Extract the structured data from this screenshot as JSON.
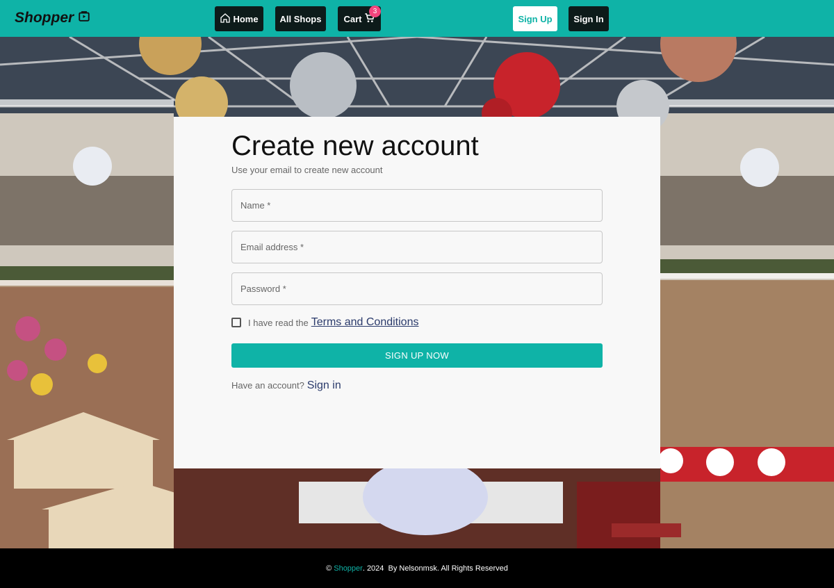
{
  "header": {
    "logo_text": "Shopper",
    "nav": {
      "home_label": "Home",
      "shops_label": "All Shops",
      "cart_label": "Cart",
      "cart_count": "3"
    },
    "signup_label": "Sign Up",
    "signin_label": "Sign In",
    "colors": {
      "brand": "#0fb3a7",
      "badge": "#f2457d",
      "nav_bg": "#0d1b1a"
    }
  },
  "form": {
    "title": "Create new account",
    "subtitle": "Use your email to create new account",
    "name_placeholder": "Name *",
    "email_placeholder": "Email address *",
    "password_placeholder": "Password *",
    "terms_prefix": "I have read the",
    "terms_link": "Terms and Conditions",
    "submit_label": "SIGN UP NOW",
    "have_account_text": "Have an account?",
    "signin_link": "Sign in"
  },
  "footer": {
    "copyright_symbol": "©",
    "brand": "Shopper",
    "rest": ". 2024  By Nelsonmsk. All Rights Reserved"
  },
  "icons": {
    "logo": "shopping-bag-icon",
    "home": "home-icon",
    "cart": "cart-icon"
  }
}
